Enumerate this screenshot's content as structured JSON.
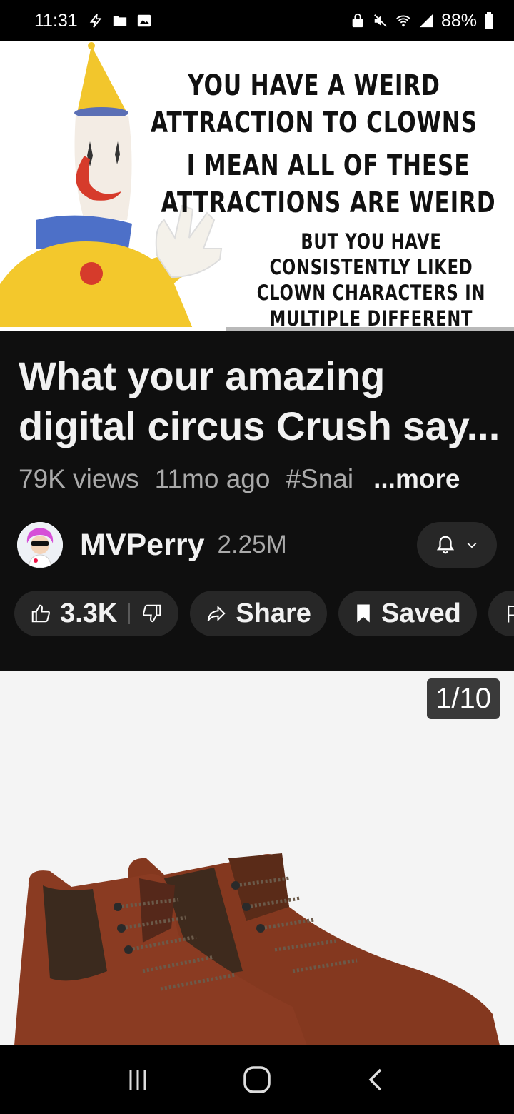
{
  "status_bar": {
    "time": "11:31",
    "battery": "88%"
  },
  "video": {
    "caption_line1": "YOU HAVE A WEIRD ATTRACTION TO CLOWNS",
    "caption_line2": "I MEAN ALL OF THESE ATTRACTIONS ARE WEIRD",
    "caption_line3": "BUT YOU HAVE CONSISTENTLY LIKED CLOWN CHARACTERS IN MULTIPLE DIFFERENT SHOWS OR GAMES",
    "progress": 0.44
  },
  "info": {
    "title": "What your amazing digital circus Crush say...",
    "views": "79K views",
    "age": "11mo ago",
    "hashtag": "#Snai",
    "more": "...more"
  },
  "channel": {
    "name": "MVPerry",
    "subscribers": "2.25M"
  },
  "actions": {
    "likes": "3.3K",
    "share": "Share",
    "saved": "Saved"
  },
  "product": {
    "counter": "1/10"
  },
  "colors": {
    "background": "#0f0f0f",
    "pill": "#272727",
    "secondary_text": "#aaaaaa",
    "boot_leather": "#8a3b22"
  }
}
